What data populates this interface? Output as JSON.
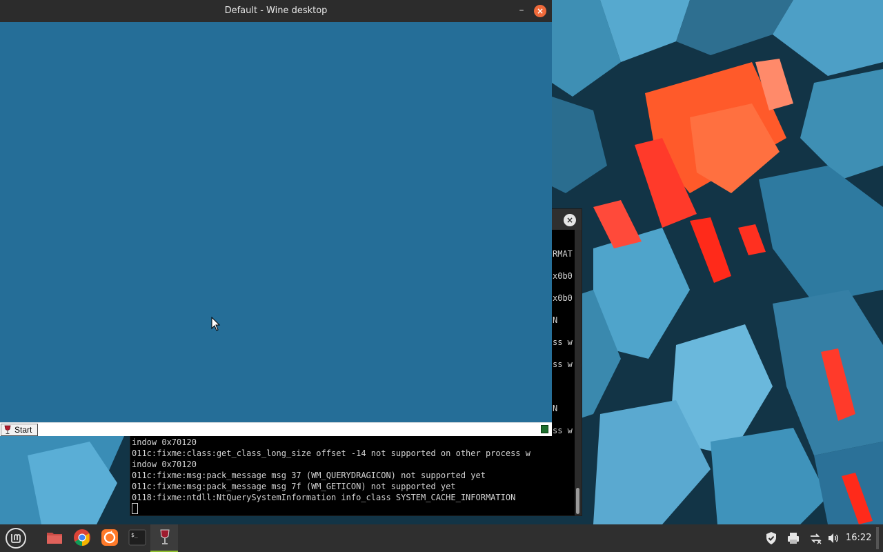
{
  "wine_window": {
    "title": "Default - Wine desktop",
    "minimize_glyph": "–",
    "close_glyph": "×",
    "start_label": "Start",
    "start_icon": "wine-glass-icon",
    "desktop_color": "#256e98"
  },
  "terminal": {
    "close_glyph": "×",
    "partial_lines": [
      "RMAT",
      "x0b0",
      "x0b0",
      "N",
      "ss w",
      "ss w",
      "N",
      "ss w"
    ],
    "lines": [
      "indow 0x70120",
      "011c:fixme:class:get_class_long_size offset -14 not supported on other process w",
      "indow 0x70120",
      "011c:fixme:msg:pack_message msg 37 (WM_QUERYDRAGICON) not supported yet",
      "011c:fixme:msg:pack_message msg 7f (WM_GETICON) not supported yet",
      "0118:fixme:ntdll:NtQuerySystemInformation info_class SYSTEM_CACHE_INFORMATION"
    ]
  },
  "panel": {
    "menu_icon": "linux-mint-menu-icon",
    "launchers": [
      {
        "name": "files-icon",
        "color": "#d9534f"
      },
      {
        "name": "chrome-icon",
        "color": "#34a853"
      },
      {
        "name": "firefox-icon",
        "color": "#ff7a2a"
      },
      {
        "name": "terminal-icon",
        "color": "#1e1e1e"
      },
      {
        "name": "wine-icon",
        "color": "#9e1b2e"
      }
    ],
    "tray": [
      "shield-icon",
      "printer-icon",
      "network-icon",
      "volume-icon"
    ],
    "clock": "16:22"
  }
}
